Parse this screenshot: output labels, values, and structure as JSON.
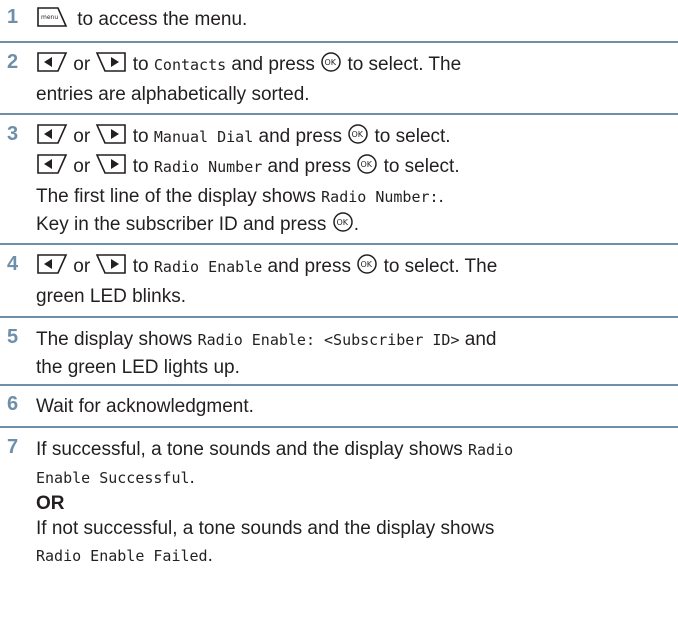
{
  "steps": [
    {
      "num": "1",
      "t1": "to access the menu.",
      "icon_menu": "menu-key-icon"
    },
    {
      "num": "2",
      "or": "or",
      "to": "to",
      "screen": "Contacts",
      "press": "and press",
      "select": "to select. The",
      "line2": "entries are alphabetically sorted."
    },
    {
      "num": "3",
      "l1_or": "or",
      "l1_to": "to",
      "l1_screen": "Manual Dial",
      "l1_press": "and press",
      "l1_select": "to select.",
      "l2_or": "or",
      "l2_to": "to",
      "l2_screen": "Radio Number",
      "l2_press": "and press",
      "l2_select": "to select.",
      "l3_text": "The first line of the display shows",
      "l3_screen": "Radio Number:",
      "l3_end": ".",
      "l4_text": "Key in the subscriber ID and press",
      "l4_end": "."
    },
    {
      "num": "4",
      "or": "or",
      "to": "to",
      "screen": "Radio Enable",
      "press": "and press",
      "select": "to select. The",
      "line2": "green LED blinks."
    },
    {
      "num": "5",
      "t1": "The display shows",
      "screen": "Radio Enable: <Subscriber ID>",
      "and": "and",
      "line2": "the green LED lights up."
    },
    {
      "num": "6",
      "t1": "Wait for acknowledgment."
    },
    {
      "num": "7",
      "t1": "If successful, a tone sounds and the display shows",
      "screen1": "Radio",
      "screen2": "Enable Successful",
      "dot": ".",
      "or": "OR",
      "t3": "If not successful, a tone sounds and the display shows",
      "screen3": "Radio Enable Failed",
      "dot2": "."
    }
  ],
  "icons": {
    "menu": "menu-key-icon",
    "left": "left-arrow-key-icon",
    "right": "right-arrow-key-icon",
    "ok": "ok-key-icon"
  },
  "colors": {
    "accent": "#6d8faa",
    "text": "#231f20"
  }
}
